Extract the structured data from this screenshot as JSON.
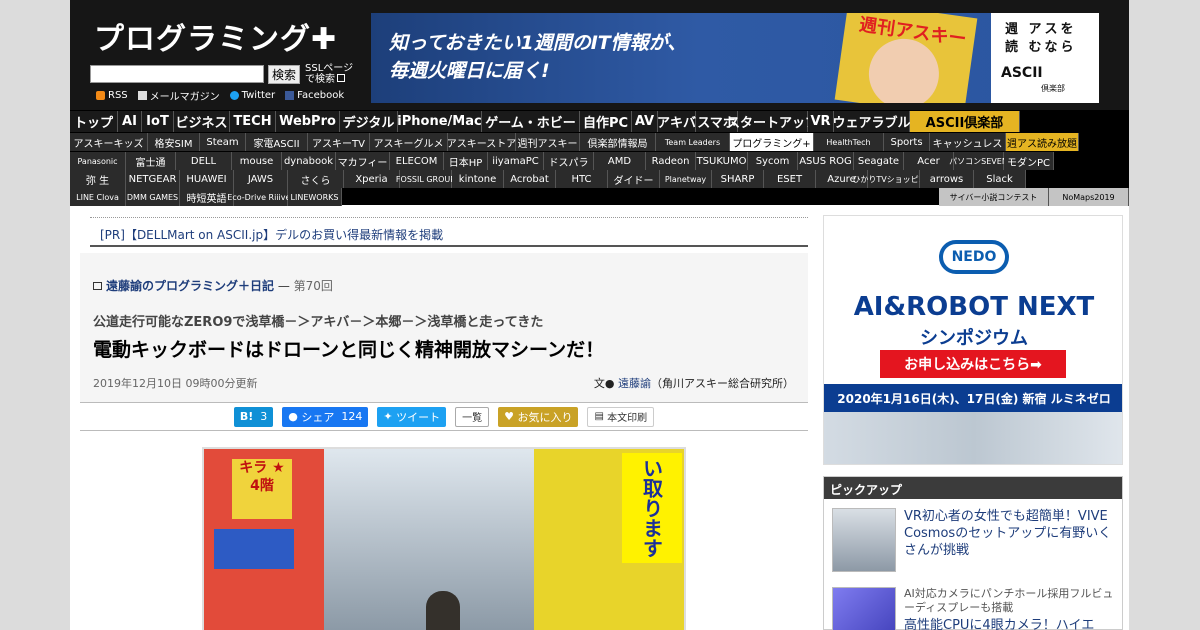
{
  "header": {
    "logo": "プログラミング✚",
    "search_button": "検索",
    "ssl_line1": "SSLページ",
    "ssl_line2": "で検索",
    "links": [
      {
        "icon": "rss-icon",
        "label": "RSS"
      },
      {
        "icon": "mail-icon",
        "label": "メールマガジン"
      },
      {
        "icon": "twitter-icon",
        "label": "Twitter"
      },
      {
        "icon": "facebook-icon",
        "label": "Facebook"
      }
    ]
  },
  "banner": {
    "line1": "知っておきたい1週間のIT情報が、",
    "line2": "毎週火曜日に届く!",
    "magazine_title": "週刊アスキー",
    "right_text_line1": "週 アスを",
    "right_text_line2": "読 むなら",
    "right_logo": "ASCII",
    "right_sub": "倶楽部"
  },
  "nav": {
    "row1": [
      "トップ",
      "AI",
      "IoT",
      "ビジネス",
      "TECH",
      "WebPro",
      "デジタル",
      "iPhone/Mac",
      "ゲーム・ホビー",
      "自作PC",
      "AV",
      "アキバ",
      "スマホ",
      "スタートアップ",
      "VR",
      "ウェアラブル",
      "ASCII倶楽部"
    ],
    "row2": [
      "アスキーキッズ",
      "格安SIM",
      "Steam",
      "家電ASCII",
      "アスキーTV",
      "アスキーグルメ",
      "アスキーストア",
      "週刊アスキー",
      "倶楽部情報局",
      "Team Leaders",
      "プログラミング+",
      "HealthTech",
      "Sports",
      "キャッシュレス",
      "週アス読み放題"
    ],
    "row3": [
      "Panasonic",
      "富士通",
      "DELL",
      "mouse",
      "dynabook",
      "マカフィー",
      "ELECOM",
      "日本HP",
      "iiyamaPC",
      "ドスパラ",
      "AMD",
      "Radeon",
      "TSUKUMO",
      "Sycom",
      "ASUS ROG",
      "Seagate",
      "Acer",
      "パソコンSEVEN",
      "モダンPC"
    ],
    "row4": [
      "弥 生",
      "NETGEAR",
      "HUAWEI",
      "JAWS",
      "さくら",
      "Xperia",
      "FOSSIL GROUP",
      "kintone",
      "Acrobat",
      "HTC",
      "ダイドー",
      "Planetway",
      "SHARP",
      "ESET",
      "Azure",
      "ひかりTVショッピング",
      "arrows",
      "Slack"
    ],
    "row5": [
      "LINE Clova",
      "DMM GAMES",
      "時短英語",
      "Eco-Drive Riiiver",
      "LINEWORKS",
      "サイバー小説コンテスト",
      "NoMaps2019"
    ]
  },
  "article": {
    "pr": "[PR]【DELLMart on ASCII.jp】デルのお買い得最新情報を掲載",
    "series_link": "遠藤諭のプログラミング＋日記",
    "series_sep": " — ",
    "series_no": "第70回",
    "subtitle": "公道走行可能なZERO9で浅草橋－＞アキバ－＞本郷－＞浅草橋と走ってきた",
    "title": "電動キックボードはドローンと同じく精神開放マシーンだ！",
    "date": "2019年12月10日 09時00分更新",
    "author_prefix": "文● ",
    "author_name": "遠藤諭",
    "author_org": "（角川アスキー総合研究所）"
  },
  "share": {
    "hatena_label": "B!",
    "hatena_count": "3",
    "fb_label": "シェア",
    "fb_count": "124",
    "tweet_label": "ツイート",
    "list_label": "一覧",
    "fav_label": "お気に入り",
    "print_label": "本文印刷"
  },
  "photo": {
    "sign_left": "キラ ★ 4階",
    "sign_right": "い取ります"
  },
  "ad": {
    "logo": "NEDO",
    "title": "AI&ROBOT NEXT",
    "subtitle": "シンポジウム",
    "cta": "お申し込みはこちら➡",
    "date": "2020年1月16日(木)、17日(金) 新宿 ルミネゼロ"
  },
  "pickup": {
    "heading": "ピックアップ",
    "items": [
      {
        "title": "VR初心者の女性でも超簡単！VIVE Cosmosのセットアップに有野いくさんが挑戦"
      },
      {
        "sub": "AI対応カメラにパンチホール採用フルビューディスプレーも搭載",
        "title": "高性能CPUに4眼カメラ！ハイエ"
      }
    ]
  },
  "colors": {
    "link": "#1e3d7b",
    "header_bg": "#161616",
    "accent_gold": "#e5b422",
    "ad_red": "#e4151f",
    "ad_blue": "#0b3d91"
  }
}
